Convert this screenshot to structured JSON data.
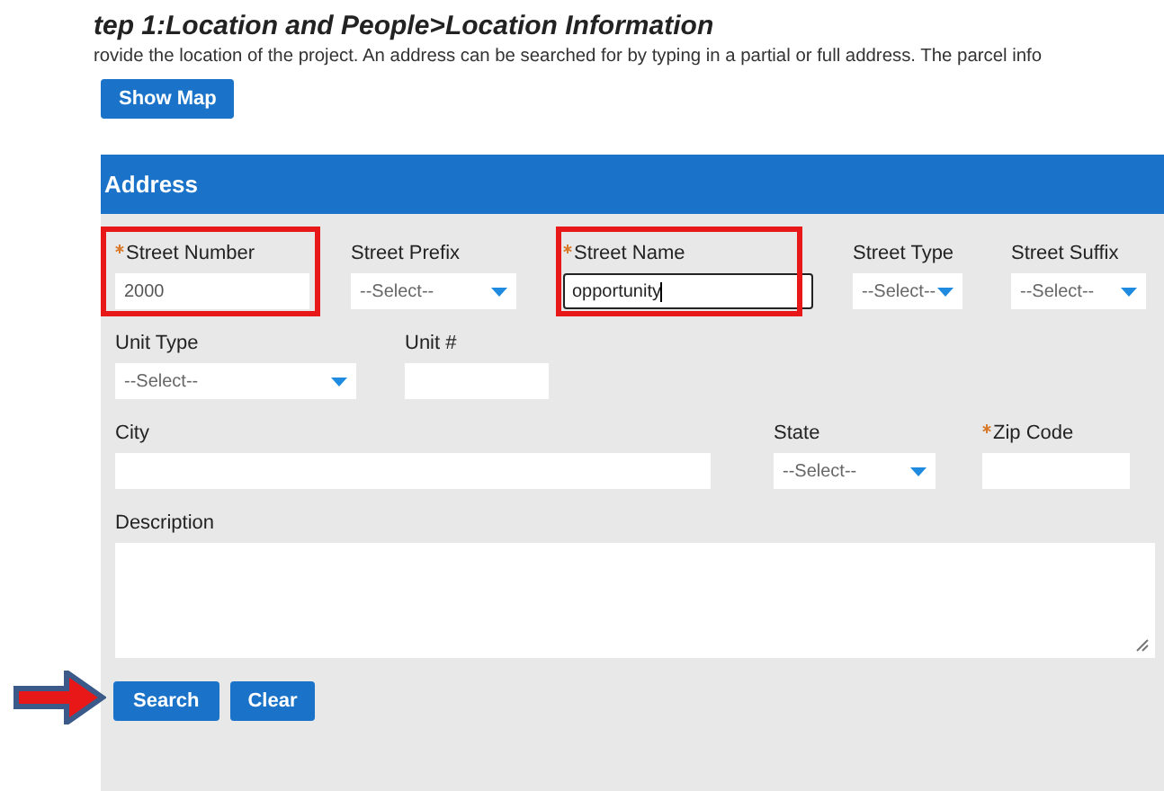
{
  "heading": "tep 1:Location and People>Location Information",
  "intro": "rovide the location of the project. An address can be searched for by typing in a partial or full address. The parcel info",
  "show_map_button": "Show Map",
  "panel": {
    "title": "Address",
    "rows": [
      {
        "fields": [
          {
            "label": "Street Number",
            "kind": "text",
            "required": true,
            "value": "2000",
            "highlighted": true,
            "focused": false
          },
          {
            "label": "Street Prefix",
            "kind": "select",
            "required": false,
            "value": "--Select--",
            "highlighted": false,
            "focused": false
          },
          {
            "label": "Street Name",
            "kind": "text",
            "required": true,
            "value": "opportunity",
            "highlighted": true,
            "focused": true
          },
          {
            "label": "Street Type",
            "kind": "select",
            "required": false,
            "value": "--Select--",
            "highlighted": false,
            "focused": false
          },
          {
            "label": "Street Suffix",
            "kind": "select",
            "required": false,
            "value": "--Select--",
            "highlighted": false,
            "focused": false
          }
        ]
      },
      {
        "fields": [
          {
            "label": "Unit Type",
            "kind": "select",
            "required": false,
            "value": "--Select--",
            "highlighted": false,
            "focused": false
          },
          {
            "label": "Unit #",
            "kind": "text",
            "required": false,
            "highlighted": false,
            "focused": false
          }
        ]
      },
      {
        "fields": [
          {
            "label": "City",
            "kind": "text",
            "required": false,
            "highlighted": false,
            "focused": false
          },
          {
            "label": "State",
            "kind": "select",
            "required": false,
            "value": "--Select--",
            "highlighted": false,
            "focused": false
          },
          {
            "label": "Zip Code",
            "kind": "text",
            "required": true,
            "highlighted": false,
            "focused": false
          }
        ]
      },
      {
        "fields": [
          {
            "label": "Description",
            "kind": "textarea",
            "required": false,
            "highlighted": false,
            "focused": false
          }
        ]
      }
    ],
    "buttons": [
      "Search",
      "Clear"
    ],
    "arrow_pointing_at_buttons": true
  }
}
